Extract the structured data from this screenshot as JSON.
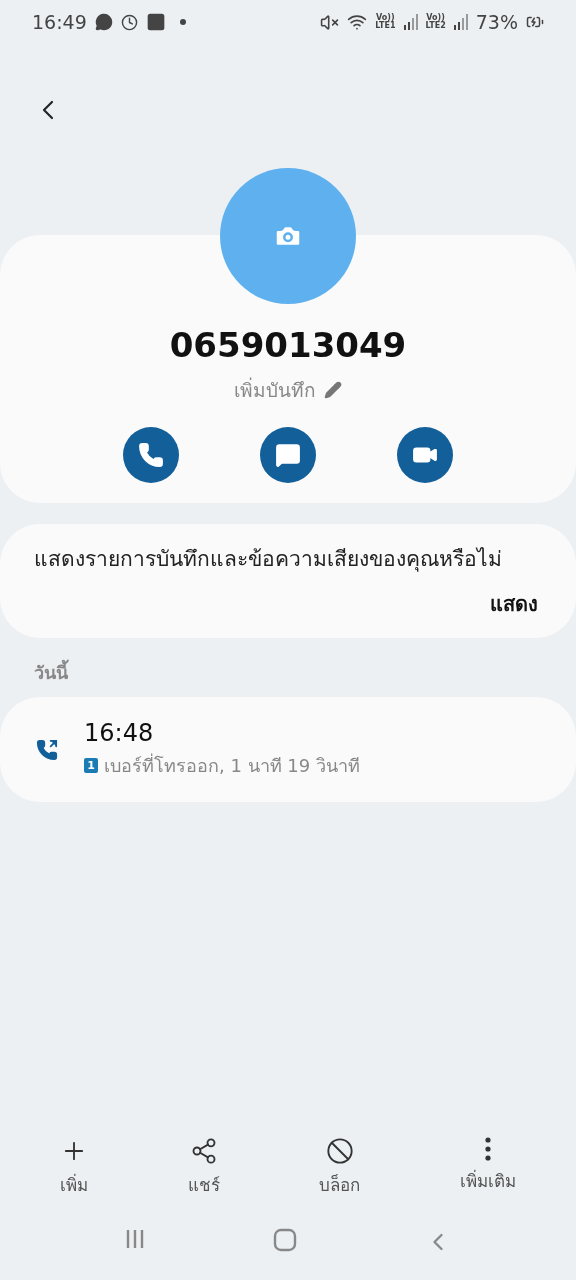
{
  "status_bar": {
    "time": "16:49",
    "sims": [
      {
        "volte": "Vo))",
        "label": "LTE1"
      },
      {
        "volte": "Vo))",
        "label": "LTE2"
      }
    ],
    "battery": "73%"
  },
  "contact": {
    "number": "0659013049",
    "note_label": "เพิ่มบันทึก",
    "actions": [
      {
        "kind": "call"
      },
      {
        "kind": "message"
      },
      {
        "kind": "video"
      }
    ]
  },
  "banner": {
    "text": "แสดงรายการบันทึกและข้อความเสียงของคุณหรือไม่",
    "action": "แสดง"
  },
  "section": "วันนี้",
  "calls": [
    {
      "kind": "outgoing",
      "time": "16:48",
      "sim": "1",
      "detail": "เบอร์ที่โทรออก, 1 นาที 19 วินาที"
    }
  ],
  "bottom_actions": [
    {
      "kind": "add",
      "label": "เพิ่ม"
    },
    {
      "kind": "share",
      "label": "แชร์"
    },
    {
      "kind": "block",
      "label": "บล็อก"
    },
    {
      "kind": "more",
      "label": "เพิ่มเติม"
    }
  ],
  "nav": [
    {
      "kind": "recents"
    },
    {
      "kind": "home"
    },
    {
      "kind": "back"
    }
  ]
}
